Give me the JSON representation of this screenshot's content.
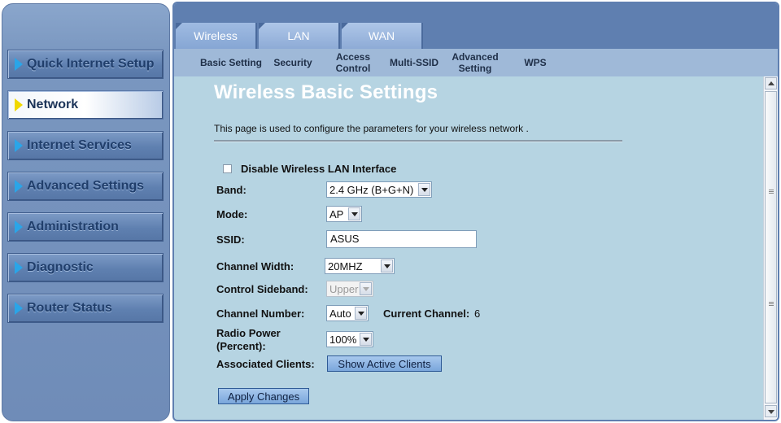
{
  "sidebar": {
    "items": [
      {
        "label": "Quick Internet Setup",
        "active": false
      },
      {
        "label": "Network",
        "active": true
      },
      {
        "label": "Internet Services",
        "active": false
      },
      {
        "label": "Advanced Settings",
        "active": false
      },
      {
        "label": "Administration",
        "active": false
      },
      {
        "label": "Diagnostic",
        "active": false
      },
      {
        "label": "Router Status",
        "active": false
      }
    ]
  },
  "tabs": [
    "Wireless",
    "LAN",
    "WAN"
  ],
  "subnav": [
    "Basic Setting",
    "Security",
    "Access Control",
    "Multi-SSID",
    "Advanced Setting",
    "WPS"
  ],
  "page": {
    "title": "Wireless Basic Settings",
    "description": "This page is used to configure the parameters for your wireless network ."
  },
  "form": {
    "disable_wireless_label": "Disable Wireless LAN Interface",
    "disable_wireless_checked": false,
    "band_label": "Band:",
    "band_value": "2.4 GHz (B+G+N)",
    "mode_label": "Mode:",
    "mode_value": "AP",
    "ssid_label": "SSID:",
    "ssid_value": "ASUS",
    "channel_width_label": "Channel Width:",
    "channel_width_value": "20MHZ",
    "control_sideband_label": "Control Sideband:",
    "control_sideband_value": "Upper",
    "channel_number_label": "Channel Number:",
    "channel_number_value": "Auto",
    "current_channel_label": "Current Channel:",
    "current_channel_value": "6",
    "radio_power_label_1": "Radio Power",
    "radio_power_label_2": "(Percent):",
    "radio_power_value": "100%",
    "associated_clients_label": "Associated Clients:",
    "show_active_clients_button": "Show Active Clients",
    "apply_button": "Apply Changes"
  },
  "colors": {
    "accent": "#5f7fb0",
    "content_bg": "#b6d4e2",
    "active_arrow": "#f0d800",
    "menu_arrow": "#2aa5e8"
  }
}
